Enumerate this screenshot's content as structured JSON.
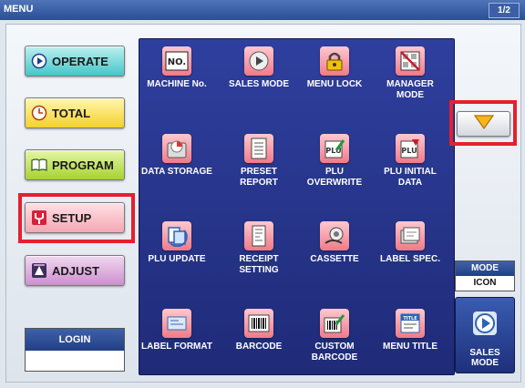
{
  "titlebar": {
    "title": "MENU",
    "page": "1/2"
  },
  "left_menu": {
    "operate": "OPERATE",
    "total": "TOTAL",
    "program": "PROGRAM",
    "setup": "SETUP",
    "adjust": "ADJUST"
  },
  "login": {
    "label": "LOGIN",
    "value": ""
  },
  "tiles": [
    {
      "label": "MACHINE No.",
      "icon": "machine-number-icon"
    },
    {
      "label": "SALES MODE",
      "icon": "sales-mode-icon"
    },
    {
      "label": "MENU LOCK",
      "icon": "lock-icon"
    },
    {
      "label": "MANAGER MODE",
      "icon": "manager-mode-icon"
    },
    {
      "label": "DATA STORAGE",
      "icon": "data-storage-icon"
    },
    {
      "label": "PRESET REPORT",
      "icon": "preset-report-icon"
    },
    {
      "label": "PLU OVERWRITE",
      "icon": "plu-overwrite-icon"
    },
    {
      "label": "PLU INITIAL DATA",
      "icon": "plu-initial-data-icon"
    },
    {
      "label": "PLU UPDATE",
      "icon": "plu-update-icon"
    },
    {
      "label": "RECEIPT SETTING",
      "icon": "receipt-setting-icon"
    },
    {
      "label": "CASSETTE",
      "icon": "cassette-icon"
    },
    {
      "label": "LABEL SPEC.",
      "icon": "label-spec-icon"
    },
    {
      "label": "LABEL FORMAT",
      "icon": "label-format-icon"
    },
    {
      "label": "BARCODE",
      "icon": "barcode-icon"
    },
    {
      "label": "CUSTOM BARCODE",
      "icon": "custom-barcode-icon"
    },
    {
      "label": "MENU TITLE",
      "icon": "menu-title-icon"
    }
  ],
  "mode": {
    "label": "MODE",
    "value": "ICON"
  },
  "sales_mode_button": {
    "label": "SALES MODE"
  },
  "highlight_color": "#e5202e"
}
